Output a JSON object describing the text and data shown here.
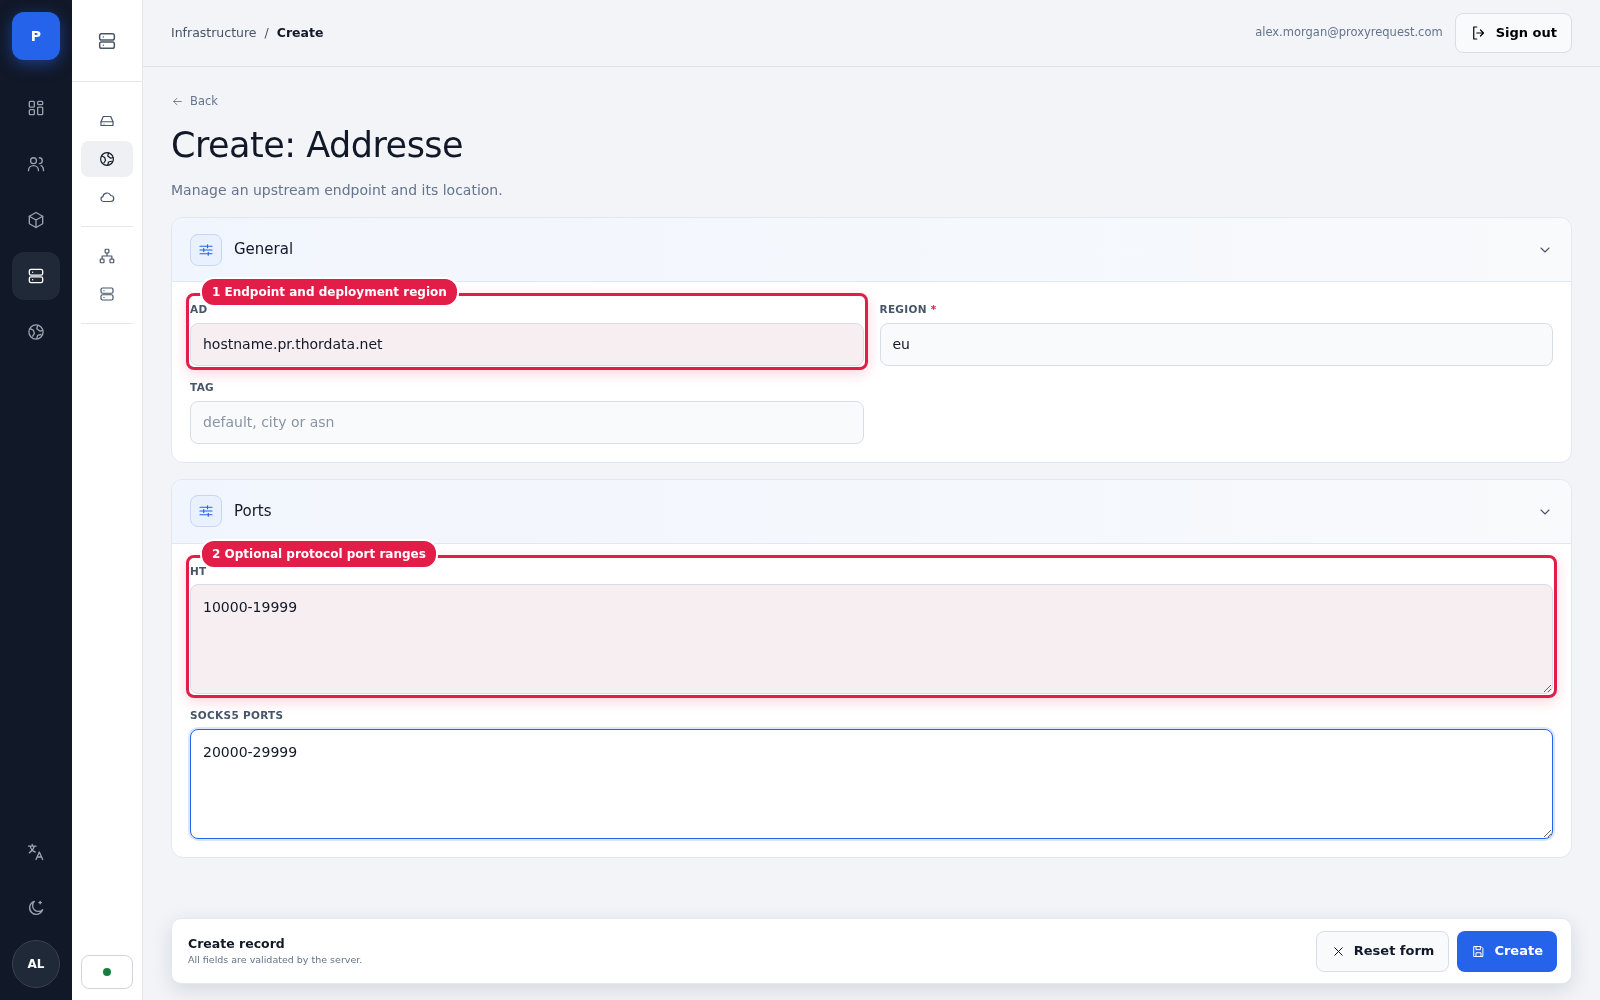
{
  "rail": {
    "logo": "P",
    "items": [
      {
        "selected": false
      },
      {
        "selected": false
      },
      {
        "selected": false
      },
      {
        "selected": true
      },
      {
        "selected": false
      }
    ],
    "avatar": "AL"
  },
  "subnav": {
    "items": [
      {
        "selected": false
      },
      {
        "selected": true
      },
      {
        "selected": false
      },
      {
        "selected": false
      },
      {
        "selected": false
      }
    ],
    "status": {
      "color": "#15803d"
    }
  },
  "topbar": {
    "breadcrumb": [
      "Infrastructure",
      "Create"
    ],
    "separator": "/",
    "user": "alex.morgan@proxyrequest.com",
    "sign_out": "Sign out"
  },
  "page": {
    "back": "Back",
    "title": "Create: Addresse",
    "subtitle": "Manage an upstream endpoint and its location."
  },
  "required_mark": "*",
  "sections": [
    {
      "title": "General",
      "expanded": true,
      "fields": [
        {
          "kind": "input",
          "label": "AD",
          "value": "hostname.pr.thordata.net",
          "required": false,
          "focused": false,
          "callout": "1 Endpoint and deployment region"
        },
        {
          "kind": "input",
          "label": "REGION",
          "value": "eu",
          "required": true,
          "focused": false
        },
        {
          "kind": "input",
          "label": "TAG",
          "placeholder": "default, city or asn",
          "required": false,
          "focused": false
        }
      ]
    },
    {
      "title": "Ports",
      "expanded": true,
      "fields": [
        {
          "kind": "textarea",
          "label": "HT",
          "value": "10000-19999",
          "required": false,
          "focused": false,
          "callout": "2 Optional protocol port ranges"
        },
        {
          "kind": "textarea",
          "label": "SOCKS5 PORTS",
          "value": "20000-29999",
          "required": false,
          "focused": true
        }
      ]
    }
  ],
  "footer": {
    "title": "Create record",
    "note": "All fields are validated by the server.",
    "buttons": [
      {
        "kind": "secondary",
        "label": "Reset form"
      },
      {
        "kind": "primary",
        "label": "Create"
      }
    ]
  }
}
